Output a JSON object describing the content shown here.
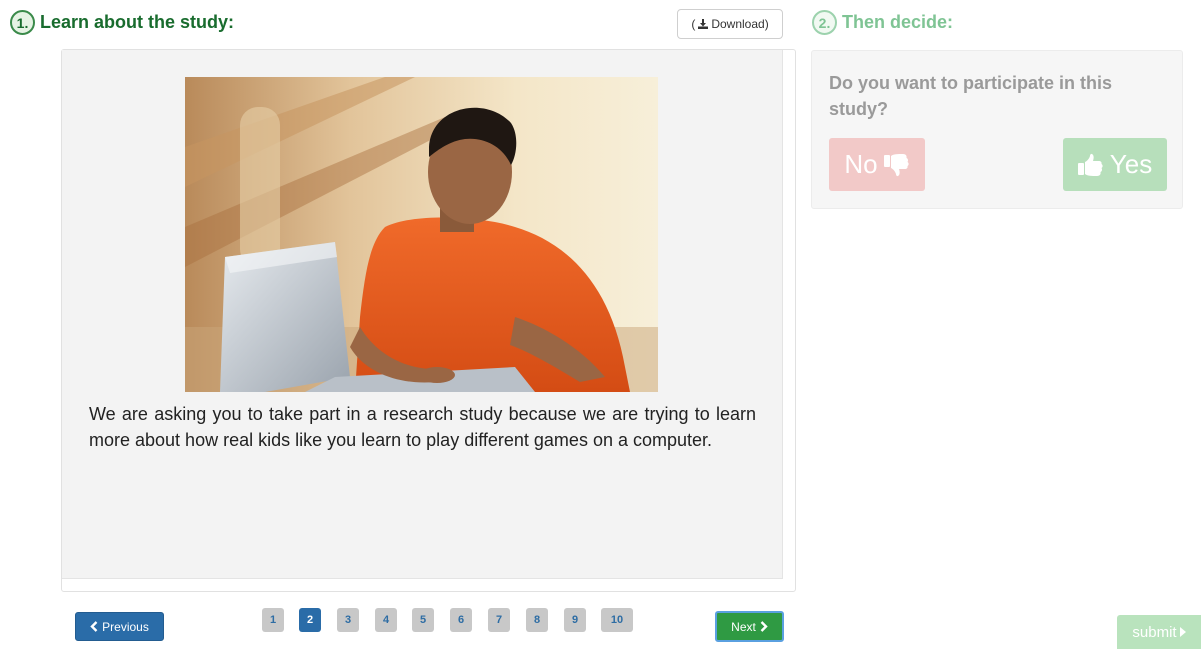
{
  "step1": {
    "number": "1.",
    "title": "Learn about the study:"
  },
  "step2": {
    "number": "2.",
    "title": "Then decide:"
  },
  "download": {
    "label": "Download",
    "open_paren": "(",
    "close_paren": ")",
    "icon": "download-icon"
  },
  "study": {
    "image_description_icon": "photo",
    "text": "We are asking you to take part in a research study because we are trying to learn more about how real kids like you learn to play different games on a computer."
  },
  "navigation": {
    "previous_label": "Previous",
    "next_label": "Next",
    "pages": [
      "1",
      "2",
      "3",
      "4",
      "5",
      "6",
      "7",
      "8",
      "9",
      "10"
    ],
    "active_page": "2"
  },
  "decide": {
    "question": "Do you want to participate in this study?",
    "no_label": "No",
    "yes_label": "Yes",
    "no_icon": "thumbs-down-icon",
    "yes_icon": "thumbs-up-icon"
  },
  "submit": {
    "label": "submit"
  },
  "colors": {
    "step1_green": "#196c2e",
    "step2_green": "#7fc494",
    "primary_blue": "#2a6ca8",
    "next_green": "#2f9a43",
    "no_red_light": "#f2c9c8",
    "yes_green_light": "#b7dfbb"
  }
}
